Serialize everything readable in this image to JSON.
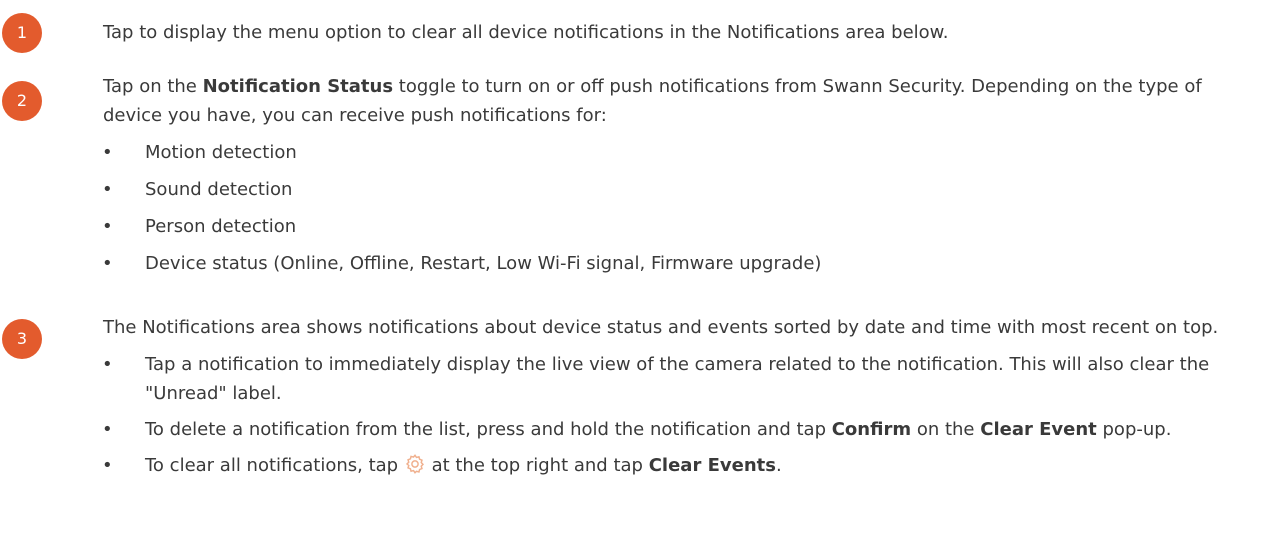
{
  "steps": [
    {
      "number": "1",
      "text": "Tap to display the menu option to clear all device notifications in the Notifications area below."
    },
    {
      "number": "2",
      "intro_before": "Tap on the ",
      "intro_bold": "Notification Status",
      "intro_after": " toggle to turn on or off push notifications from Swann Security. Depending on the type of device you have, you can receive push notifications for:",
      "bullets": [
        "Motion detection",
        "Sound detection",
        "Person detection",
        "Device status (Online, Offline, Restart, Low Wi-Fi signal, Firmware upgrade)"
      ]
    },
    {
      "number": "3",
      "intro": "The Notifications area shows notifications about device status and events sorted by date and time with most recent on top.",
      "bullet1": "Tap a notification to immediately display the live view of the camera related to the notification. This will also clear the \"Unread\" label.",
      "bullet2": {
        "a": "To delete a notification from the list, press and hold the notification and tap ",
        "b": "Confirm",
        "c": " on the ",
        "d": "Clear Event",
        "e": " pop-up."
      },
      "bullet3": {
        "a": "To clear all notifications, tap ",
        "icon": "gear-icon",
        "b": " at the top right and tap ",
        "c": "Clear Events",
        "d": "."
      }
    }
  ],
  "bullet_char": "•",
  "colors": {
    "badge": "#e35b2d",
    "text": "#3a3a3a",
    "icon": "#f0b08e"
  }
}
